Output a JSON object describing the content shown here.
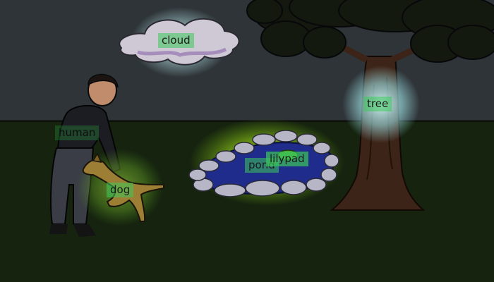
{
  "scene": {
    "colors": {
      "sky": "#2e3438",
      "grass": "#15230f",
      "cloud_glow": "#c7eef0",
      "tree_glow": "#bff2f2",
      "dog_glow": "#9fe04a",
      "pond_glow": "#b6f01e",
      "label_bg": "#3cc85a",
      "water": "#1f2c8c",
      "trunk": "#3d2418",
      "leaves": "#14190f"
    },
    "objects": [
      {
        "id": "cloud",
        "label": "cloud",
        "highlighted": true
      },
      {
        "id": "tree",
        "label": "tree",
        "highlighted": true
      },
      {
        "id": "human",
        "label": "human",
        "highlighted": false
      },
      {
        "id": "dog",
        "label": "dog",
        "highlighted": true
      },
      {
        "id": "pond",
        "label": "pond",
        "highlighted": true
      },
      {
        "id": "lilypad",
        "label": "lilypad",
        "highlighted": true
      }
    ]
  }
}
